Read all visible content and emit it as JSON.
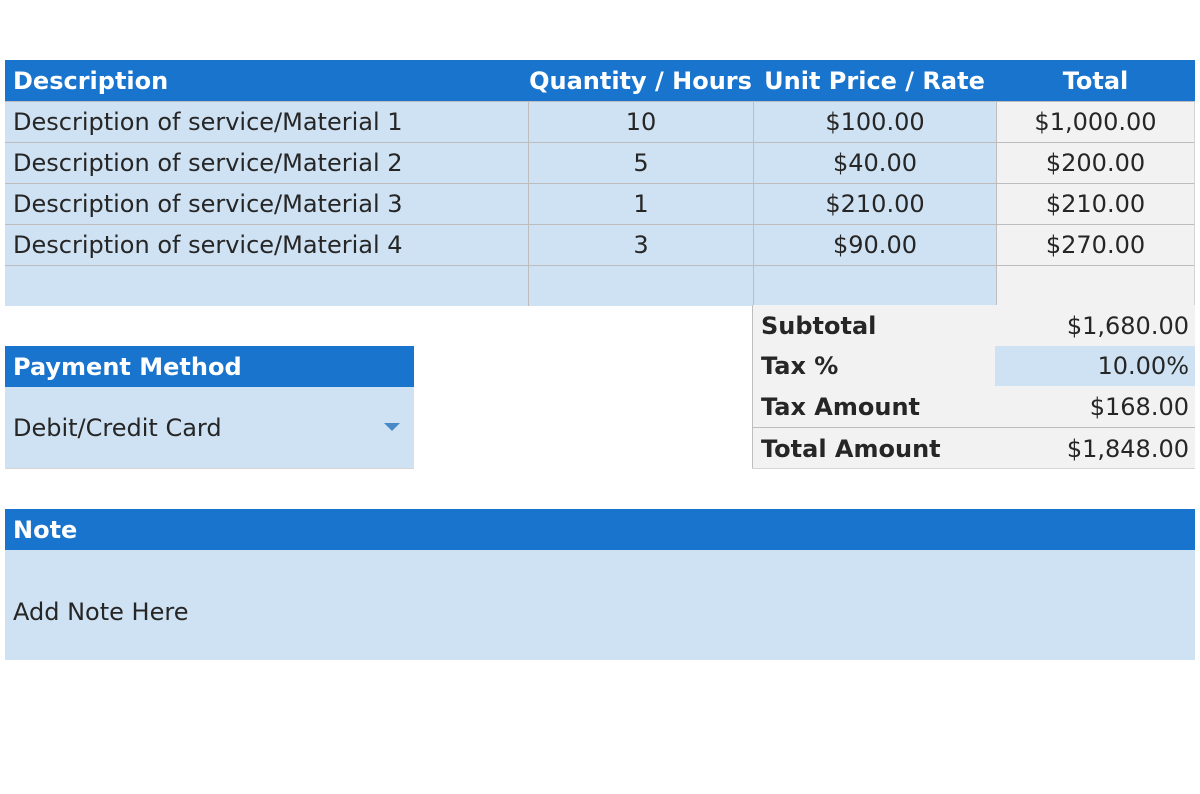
{
  "colors": {
    "header": "#1874cd",
    "light_cell": "#cfe2f3",
    "grey_cell": "#f2f2f2",
    "grid": "#bdbdbd"
  },
  "items": {
    "headers": {
      "description": "Description",
      "quantity": "Quantity / Hours",
      "unit_price": "Unit Price / Rate",
      "total": "Total"
    },
    "rows": [
      {
        "description": "Description of service/Material 1",
        "quantity": "10",
        "unit_price": "$100.00",
        "total": "$1,000.00"
      },
      {
        "description": "Description of service/Material 2",
        "quantity": "5",
        "unit_price": "$40.00",
        "total": "$200.00"
      },
      {
        "description": "Description of service/Material 3",
        "quantity": "1",
        "unit_price": "$210.00",
        "total": "$210.00"
      },
      {
        "description": "Description of service/Material 4",
        "quantity": "3",
        "unit_price": "$90.00",
        "total": "$270.00"
      },
      {
        "description": "",
        "quantity": "",
        "unit_price": "",
        "total": ""
      }
    ]
  },
  "summary": {
    "subtotal_label": "Subtotal",
    "subtotal_value": "$1,680.00",
    "tax_pct_label": "Tax %",
    "tax_pct_value": "10.00%",
    "tax_amount_label": "Tax Amount",
    "tax_amount_value": "$168.00",
    "total_label": "Total Amount",
    "total_value": "$1,848.00"
  },
  "payment": {
    "title": "Payment Method",
    "selected": "Debit/Credit Card",
    "dropdown_icon": "chevron-down-icon"
  },
  "note": {
    "title": "Note",
    "text": "Add Note Here"
  }
}
